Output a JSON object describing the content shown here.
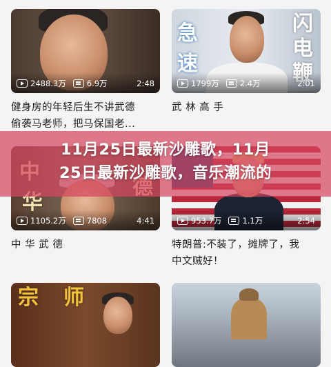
{
  "videos": [
    {
      "views": "2488.3万",
      "comments": "6.9万",
      "duration": "2:48",
      "title_lines": [
        "健身房的年轻后生不讲武德",
        "偷袭马老师，把马保国老..."
      ]
    },
    {
      "views": "1799万",
      "comments": "2.4万",
      "duration": "2:01",
      "title_lines": [
        "武 林 高 手",
        ""
      ],
      "thumb_text": [
        "急",
        "速",
        "闪",
        "电",
        "鞭"
      ]
    },
    {
      "views": "1105.2万",
      "comments": "7808",
      "duration": "4:41",
      "title_lines": [
        "中 华 武 德",
        ""
      ],
      "thumb_text": [
        "中",
        "华",
        "德"
      ]
    },
    {
      "views": "953.7万",
      "comments": "1.1万",
      "duration": "2:54",
      "title_lines": [
        "特朗普:不装了，摊牌了，我",
        "中文贼好！"
      ]
    },
    {
      "views": "",
      "comments": "",
      "duration": "",
      "title_lines": [
        "",
        ""
      ],
      "thumb_text": [
        "宗",
        "师"
      ]
    },
    {
      "views": "",
      "comments": "",
      "duration": "",
      "title_lines": [
        "",
        ""
      ]
    }
  ],
  "banner": {
    "lines": [
      "11月25日最新沙雕歌，11月",
      "25日最新沙雕歌，音乐潮流的"
    ],
    "color": "#d64660"
  },
  "icons": {
    "views": "play-icon",
    "comments": "danmaku-icon"
  }
}
